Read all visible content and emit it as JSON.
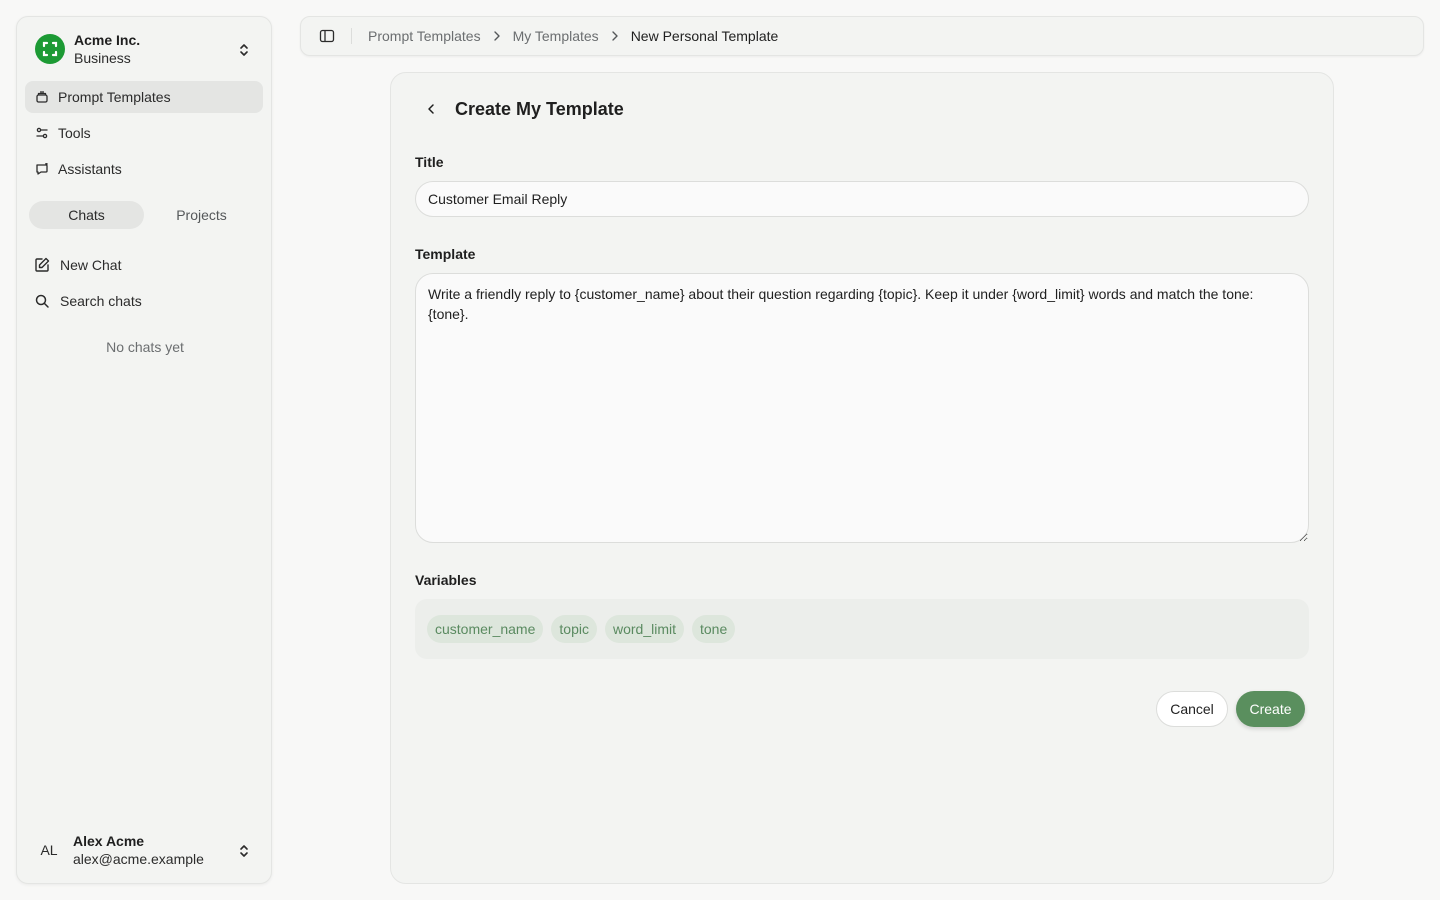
{
  "org": {
    "name": "Acme Inc.",
    "plan": "Business"
  },
  "nav": {
    "items": [
      {
        "label": "Prompt Templates",
        "icon": "prompt-templates-icon",
        "active": true
      },
      {
        "label": "Tools",
        "icon": "tools-icon",
        "active": false
      },
      {
        "label": "Assistants",
        "icon": "assistants-icon",
        "active": false
      }
    ]
  },
  "segment": {
    "chats": "Chats",
    "projects": "Projects",
    "active": "Chats"
  },
  "chat_actions": {
    "new_chat": "New Chat",
    "search_chats": "Search chats"
  },
  "empty_state": "No chats yet",
  "user": {
    "initials": "AL",
    "name": "Alex Acme",
    "email": "alex@acme.example"
  },
  "breadcrumb": {
    "items": [
      "Prompt Templates",
      "My Templates",
      "New Personal Template"
    ]
  },
  "form": {
    "heading": "Create My Template",
    "title_label": "Title",
    "title_value": "Customer Email Reply",
    "template_label": "Template",
    "template_value": "Write a friendly reply to {customer_name} about their question regarding {topic}. Keep it under {word_limit} words and match the tone: {tone}.",
    "variables_label": "Variables",
    "variables": [
      "customer_name",
      "topic",
      "word_limit",
      "tone"
    ],
    "cancel_label": "Cancel",
    "create_label": "Create"
  },
  "colors": {
    "brand_green": "#1c9a34",
    "primary_button": "#5a8f5e",
    "chip_bg": "#dde6dc",
    "chip_text": "#5a8a60"
  }
}
